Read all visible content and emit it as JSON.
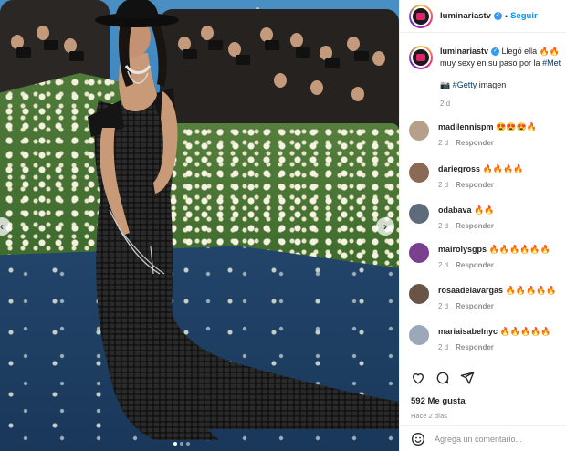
{
  "post": {
    "username": "luminariastv",
    "follow_label": "Seguir",
    "separator": "•",
    "caption_user": "luminariastv",
    "caption_line1": "Llegó ella 🔥🔥",
    "caption_line2": "muy sexy en su paso por la",
    "caption_hashtag": "#Met",
    "caption_credit_icon": "📷",
    "caption_credit_tag": "#Getty",
    "caption_credit_text": "imagen",
    "caption_time": "2 d",
    "nav_prev": "‹",
    "nav_next": "›",
    "likes": "592 Me gusta",
    "time_ago": "Hace 2 días",
    "comment_placeholder": "Agrega un comentario...",
    "reply_label": "Responder"
  },
  "comments": [
    {
      "user": "madilennispm",
      "text": "😍😍😍🔥",
      "time": "2 d",
      "color": "#b7a08a"
    },
    {
      "user": "dariegross",
      "text": "🔥🔥🔥🔥",
      "time": "2 d",
      "color": "#8a6a55"
    },
    {
      "user": "odabava",
      "text": "🔥🔥",
      "time": "2 d",
      "color": "#5d6b7a"
    },
    {
      "user": "mairolysgps",
      "text": "🔥🔥🔥🔥🔥🔥",
      "time": "2 d",
      "color": "#7a3f8e"
    },
    {
      "user": "rosaadelavargas",
      "text": "🔥🔥🔥🔥🔥",
      "time": "2 d",
      "color": "#6a5448"
    },
    {
      "user": "mariaisabelnyc",
      "text": "🔥🔥🔥🔥🔥",
      "time": "2 d",
      "color": "#9aa8b8"
    }
  ],
  "icons": [
    "heart-icon",
    "comment-icon",
    "share-icon",
    "emoji-icon"
  ]
}
